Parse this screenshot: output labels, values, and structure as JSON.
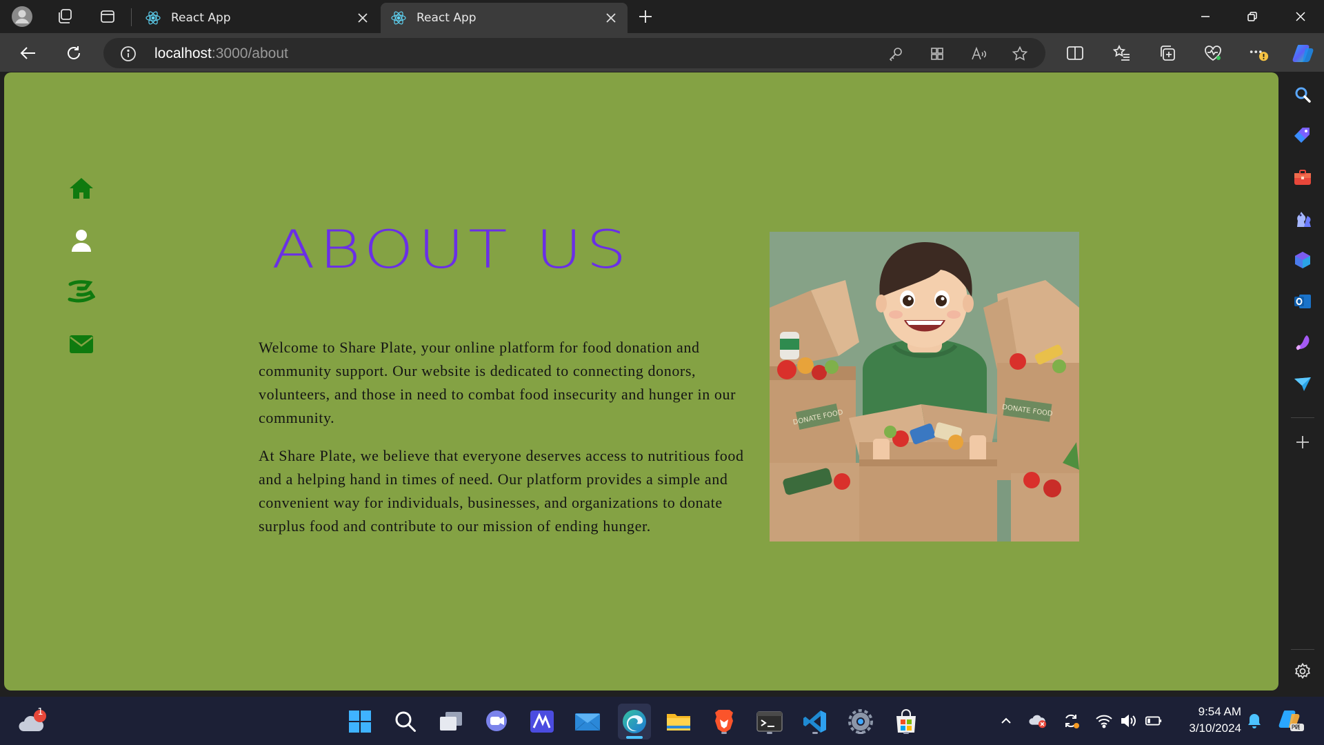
{
  "browser": {
    "tabs": [
      {
        "title": "React App",
        "active": false
      },
      {
        "title": "React App",
        "active": true
      }
    ],
    "address": {
      "host": "localhost",
      "path": ":3000/about"
    }
  },
  "colors": {
    "page_background": "#84a244",
    "title_color": "#6a2fe6",
    "nav_icon_green": "#0f7a0f",
    "text_color": "#141414"
  },
  "page": {
    "nav_icons": [
      "home-icon",
      "user-icon",
      "hand-donate-icon",
      "envelope-icon"
    ],
    "title": "ABOUT US",
    "paragraphs": [
      "Welcome to Share Plate, your online platform for food donation and community support. Our website is dedicated to connecting donors, volunteers, and those in need to combat food insecurity and hunger in our community.",
      "At Share Plate, we believe that everyone deserves access to nutritious food and a helping hand in times of need. Our platform provides a simple and convenient way for individuals, businesses, and organizations to donate surplus food and contribute to our mission of ending hunger."
    ],
    "image": {
      "box_label_left": "DONATE FOOD",
      "box_label_right": "DONATE FOOD"
    }
  },
  "taskbar": {
    "weather_badge": "1",
    "clock_time": "9:54 AM",
    "clock_date": "3/10/2024"
  }
}
